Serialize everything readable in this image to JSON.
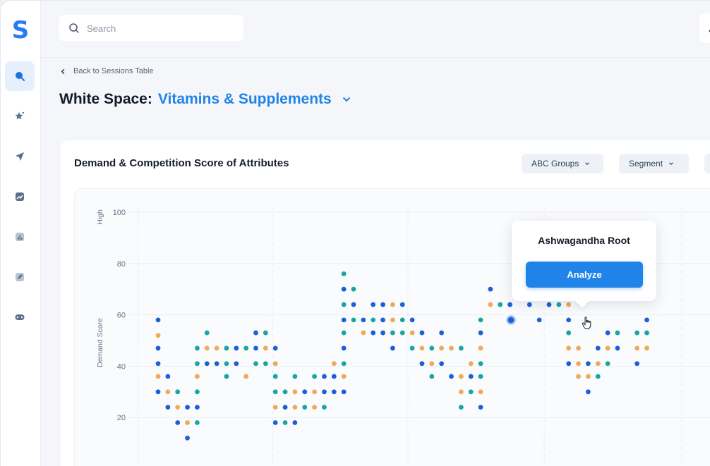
{
  "app": {
    "logo": "S"
  },
  "sidebar": {
    "items": [
      {
        "icon": "search-icon",
        "active": true
      },
      {
        "icon": "star-sparkle-icon",
        "active": false
      },
      {
        "icon": "send-icon",
        "active": false
      },
      {
        "icon": "trend-chart-icon",
        "active": false
      },
      {
        "icon": "bar-chart-icon",
        "active": false
      },
      {
        "icon": "edit-icon",
        "active": false
      },
      {
        "icon": "gamepad-icon",
        "active": false
      }
    ]
  },
  "search": {
    "placeholder": "Search",
    "value": ""
  },
  "breadcrumb": {
    "back_label": "Back to Sessions Table"
  },
  "page": {
    "title_prefix": "White Space:",
    "title_value": "Vitamins & Supplements"
  },
  "card": {
    "title": "Demand & Competition Score of Attributes",
    "filters": [
      {
        "label": "ABC Groups"
      },
      {
        "label": "Segment"
      }
    ]
  },
  "tooltip": {
    "title": "Ashwagandha Root",
    "button_label": "Analyze"
  },
  "colors": {
    "accent": "#1f83e8",
    "dot_blue": "#1d5fd9",
    "dot_orange": "#efa95a",
    "dot_teal": "#17a6a1"
  },
  "chart_data": {
    "type": "scatter",
    "ylabel": "Demand Score",
    "ylabel_top": "High",
    "ylim": [
      0,
      100
    ],
    "yticks": [
      20,
      40,
      60,
      80,
      100
    ],
    "grid": true,
    "series_colors": [
      "blue",
      "orange",
      "teal"
    ],
    "points": [
      [
        0,
        58,
        "b"
      ],
      [
        0,
        52,
        "o"
      ],
      [
        0,
        47,
        "b"
      ],
      [
        0,
        41,
        "b"
      ],
      [
        0,
        36,
        "o"
      ],
      [
        0,
        30,
        "b"
      ],
      [
        1,
        36,
        "b"
      ],
      [
        1,
        30,
        "o"
      ],
      [
        1,
        24,
        "b"
      ],
      [
        2,
        30,
        "t"
      ],
      [
        2,
        24,
        "o"
      ],
      [
        2,
        18,
        "b"
      ],
      [
        3,
        24,
        "b"
      ],
      [
        3,
        18,
        "o"
      ],
      [
        3,
        12,
        "b"
      ],
      [
        4,
        24,
        "b"
      ],
      [
        4,
        18,
        "t"
      ],
      [
        4,
        30,
        "t"
      ],
      [
        4,
        36,
        "o"
      ],
      [
        4,
        41,
        "t"
      ],
      [
        4,
        47,
        "t"
      ],
      [
        5,
        53,
        "t"
      ],
      [
        5,
        47,
        "o"
      ],
      [
        5,
        41,
        "b"
      ],
      [
        6,
        47,
        "o"
      ],
      [
        6,
        41,
        "b"
      ],
      [
        7,
        47,
        "t"
      ],
      [
        7,
        41,
        "t"
      ],
      [
        7,
        36,
        "t"
      ],
      [
        8,
        47,
        "b"
      ],
      [
        8,
        41,
        "b"
      ],
      [
        9,
        47,
        "t"
      ],
      [
        9,
        36,
        "o"
      ],
      [
        10,
        53,
        "b"
      ],
      [
        10,
        47,
        "b"
      ],
      [
        10,
        41,
        "t"
      ],
      [
        11,
        53,
        "t"
      ],
      [
        11,
        47,
        "o"
      ],
      [
        11,
        41,
        "t"
      ],
      [
        12,
        47,
        "b"
      ],
      [
        12,
        41,
        "o"
      ],
      [
        12,
        36,
        "t"
      ],
      [
        12,
        30,
        "t"
      ],
      [
        12,
        24,
        "o"
      ],
      [
        12,
        18,
        "b"
      ],
      [
        13,
        30,
        "t"
      ],
      [
        13,
        24,
        "b"
      ],
      [
        13,
        18,
        "t"
      ],
      [
        14,
        36,
        "t"
      ],
      [
        14,
        30,
        "o"
      ],
      [
        14,
        24,
        "o"
      ],
      [
        14,
        18,
        "b"
      ],
      [
        15,
        30,
        "b"
      ],
      [
        15,
        24,
        "t"
      ],
      [
        16,
        36,
        "t"
      ],
      [
        16,
        30,
        "o"
      ],
      [
        16,
        24,
        "o"
      ],
      [
        17,
        36,
        "b"
      ],
      [
        17,
        30,
        "b"
      ],
      [
        17,
        24,
        "t"
      ],
      [
        18,
        41,
        "o"
      ],
      [
        18,
        36,
        "b"
      ],
      [
        18,
        30,
        "b"
      ],
      [
        19,
        76,
        "t"
      ],
      [
        19,
        70,
        "b"
      ],
      [
        19,
        64,
        "t"
      ],
      [
        19,
        58,
        "b"
      ],
      [
        19,
        53,
        "t"
      ],
      [
        19,
        47,
        "b"
      ],
      [
        19,
        41,
        "t"
      ],
      [
        19,
        36,
        "o"
      ],
      [
        19,
        30,
        "b"
      ],
      [
        20,
        70,
        "t"
      ],
      [
        20,
        64,
        "b"
      ],
      [
        20,
        58,
        "t"
      ],
      [
        21,
        58,
        "b"
      ],
      [
        21,
        53,
        "o"
      ],
      [
        22,
        64,
        "b"
      ],
      [
        22,
        58,
        "t"
      ],
      [
        22,
        53,
        "b"
      ],
      [
        23,
        64,
        "b"
      ],
      [
        23,
        58,
        "b"
      ],
      [
        23,
        53,
        "b"
      ],
      [
        24,
        64,
        "o"
      ],
      [
        24,
        58,
        "o"
      ],
      [
        24,
        53,
        "t"
      ],
      [
        24,
        47,
        "b"
      ],
      [
        25,
        64,
        "b"
      ],
      [
        25,
        58,
        "t"
      ],
      [
        25,
        53,
        "t"
      ],
      [
        26,
        58,
        "b"
      ],
      [
        26,
        53,
        "o"
      ],
      [
        26,
        47,
        "t"
      ],
      [
        27,
        53,
        "b"
      ],
      [
        27,
        47,
        "o"
      ],
      [
        27,
        41,
        "b"
      ],
      [
        28,
        47,
        "t"
      ],
      [
        28,
        41,
        "o"
      ],
      [
        28,
        36,
        "t"
      ],
      [
        29,
        53,
        "b"
      ],
      [
        29,
        47,
        "o"
      ],
      [
        29,
        41,
        "b"
      ],
      [
        30,
        47,
        "o"
      ],
      [
        30,
        36,
        "b"
      ],
      [
        31,
        47,
        "t"
      ],
      [
        31,
        36,
        "o"
      ],
      [
        31,
        30,
        "o"
      ],
      [
        31,
        24,
        "t"
      ],
      [
        32,
        41,
        "o"
      ],
      [
        32,
        36,
        "b"
      ],
      [
        32,
        30,
        "t"
      ],
      [
        33,
        58,
        "t"
      ],
      [
        33,
        53,
        "b"
      ],
      [
        33,
        47,
        "o"
      ],
      [
        33,
        41,
        "t"
      ],
      [
        33,
        36,
        "t"
      ],
      [
        33,
        30,
        "o"
      ],
      [
        33,
        24,
        "b"
      ],
      [
        34,
        70,
        "b"
      ],
      [
        34,
        64,
        "o"
      ],
      [
        35,
        64,
        "t"
      ],
      [
        36,
        64,
        "b"
      ],
      [
        38,
        64,
        "b"
      ],
      [
        39,
        58,
        "b"
      ],
      [
        40,
        64,
        "b"
      ],
      [
        41,
        64,
        "t"
      ],
      [
        42,
        64,
        "o"
      ],
      [
        42,
        58,
        "b"
      ],
      [
        42,
        53,
        "t"
      ],
      [
        42,
        47,
        "o"
      ],
      [
        42,
        41,
        "b"
      ],
      [
        43,
        47,
        "o"
      ],
      [
        43,
        41,
        "o"
      ],
      [
        43,
        36,
        "o"
      ],
      [
        44,
        41,
        "b"
      ],
      [
        44,
        36,
        "o"
      ],
      [
        44,
        30,
        "b"
      ],
      [
        45,
        47,
        "b"
      ],
      [
        45,
        41,
        "o"
      ],
      [
        45,
        36,
        "t"
      ],
      [
        46,
        53,
        "b"
      ],
      [
        46,
        47,
        "o"
      ],
      [
        46,
        41,
        "t"
      ],
      [
        47,
        53,
        "t"
      ],
      [
        47,
        47,
        "b"
      ],
      [
        49,
        53,
        "t"
      ],
      [
        49,
        47,
        "o"
      ],
      [
        49,
        41,
        "b"
      ],
      [
        50,
        58,
        "b"
      ],
      [
        50,
        53,
        "t"
      ],
      [
        50,
        47,
        "o"
      ]
    ]
  }
}
